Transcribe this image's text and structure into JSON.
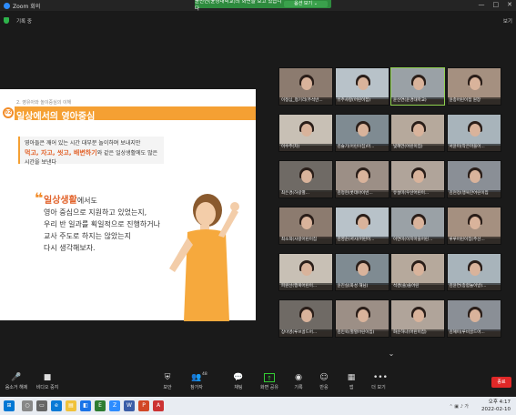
{
  "window": {
    "title": "Zoom 회의",
    "controls": [
      "—",
      "□",
      "✕"
    ]
  },
  "share_banner": {
    "text": "윤신연(윤경대학교)의 화면을 보고 있습니다",
    "view_button": "옵션 보기 ⌄"
  },
  "top_bar": {
    "recording": "기록 중",
    "view_label": "보기"
  },
  "slide": {
    "number": "02",
    "breadcrumb": "2. 영유아와 놀이중심의 이해",
    "title": "일상에서의 영아중심",
    "box_line1": "영아들은 깨어 있는 시간 대부분 놀이하며 보내지만",
    "box_highlight": "먹고, 자고, 씻고, 배변하기",
    "box_rest": "와 같은 일상생활에도 많은 시간을 보낸다",
    "quote": "❝",
    "body_em": "일상생활",
    "body_rest1": "에서도",
    "body_line2": "영아 중심으로 지원하고 있었는지,",
    "body_line3": "우리 반 일과를 획일적으로 진행하거나",
    "body_line4": "교사 주도로 하지는 않았는지",
    "body_line5": "다시 생각해보자."
  },
  "participants": [
    {
      "name": "이정심_청기리(주석반..."
    },
    {
      "name": "유주사랑(어린이집)"
    },
    {
      "name": "윤신연(윤경대학교)"
    },
    {
      "name": "윤종어린이집 원장"
    },
    {
      "name": "이수주(차)"
    },
    {
      "name": "김슬기(어린이집)마..."
    },
    {
      "name": "빛혜언(어린이집)"
    },
    {
      "name": "서윤미(작은마을어..."
    },
    {
      "name": "최은경(하랑별..."
    },
    {
      "name": "김정현(롯데아이빈..."
    },
    {
      "name": "유설미(우산어린이..."
    },
    {
      "name": "김현정(행복한어린이집"
    },
    {
      "name": "최소희(사랑어린이집"
    },
    {
      "name": "김영순(서시(어린이..."
    },
    {
      "name": "이연미(이지마을어린..."
    },
    {
      "name": "루루어린이집(주선..."
    },
    {
      "name": "피원선(행복어린이..."
    },
    {
      "name": "윤진실(화성 해님)"
    },
    {
      "name": "석경(솔)솔어린"
    },
    {
      "name": "김윤연(종합놀이방)..."
    },
    {
      "name": "장미영(루브골드어..."
    },
    {
      "name": "김민욱(별별어린이집)"
    },
    {
      "name": "화순하나(어린이집)"
    },
    {
      "name": "김혜미(루비골드어..."
    }
  ],
  "gallery_arrow": "⌄",
  "toolbar": {
    "mute": "음소거 해제",
    "video": "비디오 중지",
    "security": "보안",
    "participants": "참가자",
    "participants_count": "48",
    "chat": "채팅",
    "share": "화면 공유",
    "record": "기록",
    "reactions": "반응",
    "apps": "앱",
    "more": "더 보기",
    "end": "종료"
  },
  "taskbar": {
    "time": "오후 4:17",
    "date": "2022-02-10"
  },
  "colors": {
    "accent": "#f5a033",
    "highlight": "#e2632b",
    "end": "#e02828",
    "banner": "#2e8b3e"
  }
}
